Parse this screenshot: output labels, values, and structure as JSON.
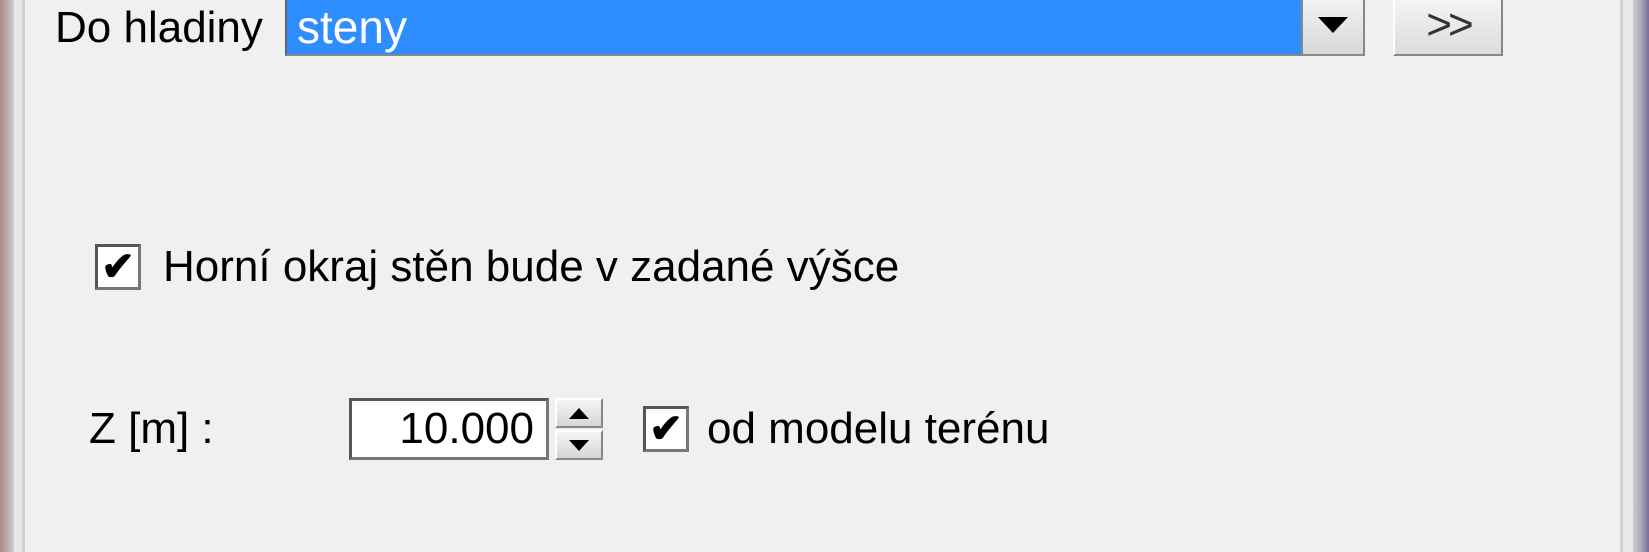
{
  "layer": {
    "label": "Do hladiny",
    "selected": "steny",
    "more_label": ">>"
  },
  "top_edge": {
    "checked": true,
    "label": "Horní okraj stěn bude v zadané výšce"
  },
  "z": {
    "label": "Z [m] :",
    "value": "10.000",
    "from_terrain_checked": true,
    "from_terrain_label": "od modelu terénu"
  }
}
